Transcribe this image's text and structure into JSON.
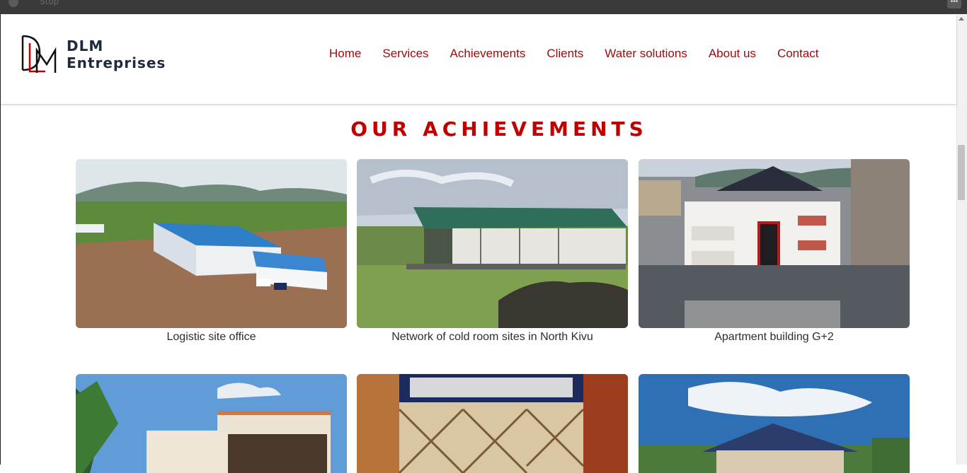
{
  "browser": {
    "tab_text": "Stop"
  },
  "brand": {
    "line1": "DLM",
    "line2": "Entreprises"
  },
  "nav": [
    "Home",
    "Services",
    "Achievements",
    "Clients",
    "Water solutions",
    "About us",
    "Contact"
  ],
  "section": {
    "title": "OUR ACHIEVEMENTS"
  },
  "achievements": [
    {
      "caption": "Logistic site office"
    },
    {
      "caption": "Network of cold room sites in North Kivu"
    },
    {
      "caption": "Apartment building G+2"
    }
  ],
  "colors": {
    "accent": "#c00000",
    "nav_text": "#9a0a0a",
    "brand_text": "#1f2b3a"
  }
}
